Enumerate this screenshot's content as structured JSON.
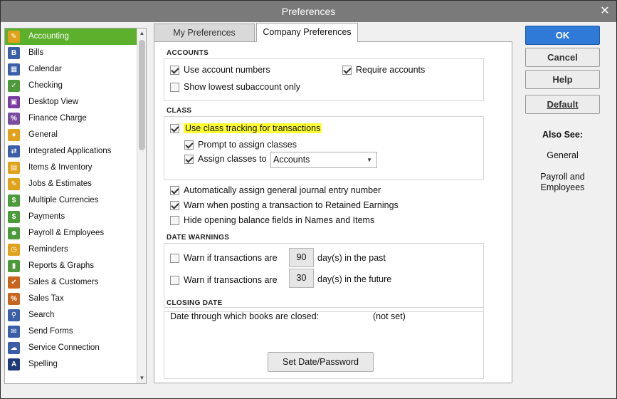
{
  "window": {
    "title": "Preferences",
    "close_glyph": "✕"
  },
  "sidebar": {
    "items": [
      {
        "label": "Accounting",
        "icon": "accounting-icon",
        "color": "#e0a21a",
        "glyph": "✎",
        "selected": true
      },
      {
        "label": "Bills",
        "icon": "bills-icon",
        "color": "#3a5ea8",
        "glyph": "B"
      },
      {
        "label": "Calendar",
        "icon": "calendar-icon",
        "color": "#3a5ea8",
        "glyph": "▦"
      },
      {
        "label": "Checking",
        "icon": "checking-icon",
        "color": "#4c9a3a",
        "glyph": "✓"
      },
      {
        "label": "Desktop View",
        "icon": "desktop-view-icon",
        "color": "#7a3aa0",
        "glyph": "▣"
      },
      {
        "label": "Finance Charge",
        "icon": "finance-charge-icon",
        "color": "#7a4ca0",
        "glyph": "%"
      },
      {
        "label": "General",
        "icon": "general-icon",
        "color": "#e0a21a",
        "glyph": "●"
      },
      {
        "label": "Integrated Applications",
        "icon": "integrated-applications-icon",
        "color": "#3a5ea8",
        "glyph": "⇄"
      },
      {
        "label": "Items & Inventory",
        "icon": "items-inventory-icon",
        "color": "#e0a21a",
        "glyph": "▤"
      },
      {
        "label": "Jobs & Estimates",
        "icon": "jobs-estimates-icon",
        "color": "#e0a21a",
        "glyph": "✎"
      },
      {
        "label": "Multiple Currencies",
        "icon": "multiple-currencies-icon",
        "color": "#4c9a3a",
        "glyph": "$"
      },
      {
        "label": "Payments",
        "icon": "payments-icon",
        "color": "#4c9a3a",
        "glyph": "$"
      },
      {
        "label": "Payroll & Employees",
        "icon": "payroll-employees-icon",
        "color": "#4c9a3a",
        "glyph": "☻"
      },
      {
        "label": "Reminders",
        "icon": "reminders-icon",
        "color": "#e0a21a",
        "glyph": "◷"
      },
      {
        "label": "Reports & Graphs",
        "icon": "reports-graphs-icon",
        "color": "#4c9a3a",
        "glyph": "▮"
      },
      {
        "label": "Sales & Customers",
        "icon": "sales-customers-icon",
        "color": "#c8641e",
        "glyph": "✔"
      },
      {
        "label": "Sales Tax",
        "icon": "sales-tax-icon",
        "color": "#c8641e",
        "glyph": "%"
      },
      {
        "label": "Search",
        "icon": "search-icon",
        "color": "#3a5ea8",
        "glyph": "⚲"
      },
      {
        "label": "Send Forms",
        "icon": "send-forms-icon",
        "color": "#3a5ea8",
        "glyph": "✉"
      },
      {
        "label": "Service Connection",
        "icon": "service-connection-icon",
        "color": "#3a5ea8",
        "glyph": "☁"
      },
      {
        "label": "Spelling",
        "icon": "spelling-icon",
        "color": "#1f3a78",
        "glyph": "A"
      }
    ]
  },
  "tabs": {
    "my_preferences_label": "My Preferences",
    "company_preferences_label": "Company Preferences"
  },
  "accounts": {
    "title": "ACCOUNTS",
    "use_account_numbers": {
      "label": "Use account numbers",
      "checked": true
    },
    "require_accounts": {
      "label": "Require accounts",
      "checked": true
    },
    "show_lowest_subaccount": {
      "label": "Show lowest subaccount only",
      "checked": false
    }
  },
  "class": {
    "title": "CLASS",
    "use_class_tracking": {
      "label": "Use class tracking for transactions",
      "checked": true
    },
    "prompt_assign": {
      "label": "Prompt to assign classes",
      "checked": true
    },
    "assign_classes_to": {
      "label": "Assign classes to",
      "checked": true,
      "value": "Accounts"
    }
  },
  "general_options": {
    "auto_assign_journal": {
      "label": "Automatically assign general journal entry number",
      "checked": true
    },
    "warn_retained_earnings": {
      "label": "Warn when posting a transaction to Retained Earnings",
      "checked": true
    },
    "hide_opening_balance": {
      "label": "Hide opening balance fields in Names and Items",
      "checked": false
    }
  },
  "date_warnings": {
    "title": "DATE WARNINGS",
    "past": {
      "label": "Warn if transactions are",
      "days": "90",
      "suffix": "day(s) in the past",
      "checked": false
    },
    "future": {
      "label": "Warn if transactions are",
      "days": "30",
      "suffix": "day(s) in the future",
      "checked": false
    }
  },
  "closing_date": {
    "title": "CLOSING DATE",
    "label": "Date through which books are closed:",
    "value": "(not set)",
    "button_label": "Set Date/Password"
  },
  "buttons": {
    "ok": "OK",
    "cancel": "Cancel",
    "help": "Help",
    "default": "Default"
  },
  "also_see": {
    "title": "Also See:",
    "links": [
      "General",
      "Payroll and Employees"
    ]
  },
  "colors": {
    "selected_green": "#5db02c",
    "ok_blue": "#2f7ad6",
    "highlight_yellow": "#ffff33"
  }
}
